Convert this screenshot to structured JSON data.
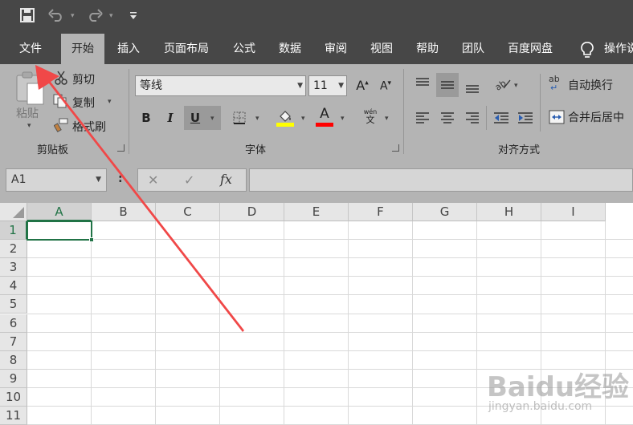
{
  "quick_access": {
    "icons": [
      "save-icon",
      "undo-icon",
      "redo-icon",
      "customize-qat-icon"
    ]
  },
  "tabs": [
    {
      "label": "文件"
    },
    {
      "label": "开始",
      "active": true
    },
    {
      "label": "插入"
    },
    {
      "label": "页面布局"
    },
    {
      "label": "公式"
    },
    {
      "label": "数据"
    },
    {
      "label": "审阅"
    },
    {
      "label": "视图"
    },
    {
      "label": "帮助"
    },
    {
      "label": "团队"
    },
    {
      "label": "百度网盘"
    },
    {
      "label": "操作说"
    }
  ],
  "ribbon": {
    "clipboard": {
      "label": "剪贴板",
      "paste": "粘贴",
      "cut": "剪切",
      "copy": "复制",
      "format_painter": "格式刷"
    },
    "font": {
      "label": "字体",
      "font_name": "等线",
      "font_size": "11",
      "bold": "B",
      "italic": "I",
      "underline": "U",
      "grow": "A",
      "shrink": "A",
      "font_color_letter": "A",
      "phonetic_top": "wén",
      "phonetic_bottom": "文",
      "fill_color": "#ffff00",
      "font_color": "#ff0000"
    },
    "alignment": {
      "label": "对齐方式",
      "wrap_text": "自动换行",
      "merge_center": "合并后居中",
      "wrap_icon_text": "ab"
    }
  },
  "formula_bar": {
    "name_box": "A1",
    "cancel": "✕",
    "enter": "✓",
    "fx": "fx",
    "colon": ":",
    "value": ""
  },
  "sheet": {
    "columns": [
      "A",
      "B",
      "C",
      "D",
      "E",
      "F",
      "G",
      "H",
      "I"
    ],
    "rows": [
      "1",
      "2",
      "3",
      "4",
      "5",
      "6",
      "7",
      "8",
      "9",
      "10",
      "11"
    ],
    "active_cell": "A1",
    "accent_color": "#217346"
  },
  "annotation": {
    "arrow_color": "#f04848"
  },
  "watermark": {
    "main": "Baidu经验",
    "sub": "jingyan.baidu.com"
  }
}
